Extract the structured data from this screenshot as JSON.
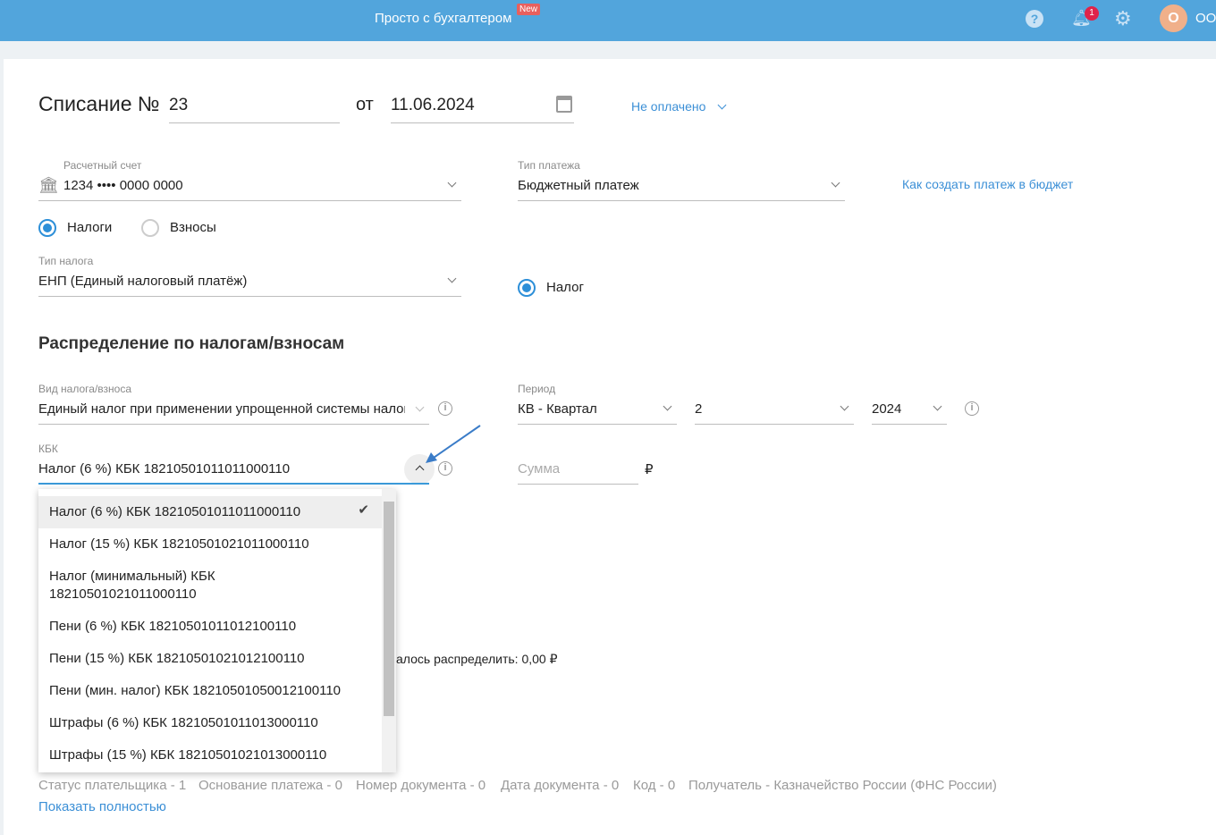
{
  "header": {
    "title": "Просто с бухгалтером",
    "new_badge": "New",
    "notif_count": "1",
    "avatar_letter": "О",
    "org": "ООО"
  },
  "doc": {
    "title": "Списание №",
    "number": "23",
    "from": "от",
    "date": "11.06.2024",
    "status": "Не оплачено"
  },
  "account": {
    "label": "Расчетный счет",
    "value": "1234 •••• 0000 0000"
  },
  "payment_type": {
    "label": "Тип платежа",
    "value": "Бюджетный платеж"
  },
  "budget_link": "Как создать платеж в бюджет",
  "radios": {
    "taxes": "Налоги",
    "contributions": "Взносы",
    "tax": "Налог"
  },
  "tax_type": {
    "label": "Тип налога",
    "value": "ЕНП (Единый налоговый платёж)"
  },
  "section_title": "Распределение по налогам/взносам",
  "kind": {
    "label": "Вид налога/взноса",
    "value": "Единый налог при применении упрощенной системы налогообложения"
  },
  "period": {
    "label": "Период",
    "type": "КВ - Квартал",
    "number": "2",
    "year": "2024"
  },
  "kbk": {
    "label": "КБК",
    "value": "Налог (6 %) КБК 18210501011011000110",
    "options": [
      "Налог (6 %) КБК 18210501011011000110",
      "Налог (15 %) КБК 18210501021011000110",
      "Налог (минимальный) КБК 18210501021011000110",
      "Пени (6 %) КБК 18210501011012100110",
      "Пени (15 %) КБК 18210501021012100110",
      "Пени (мин. налог) КБК 18210501050012100110",
      "Штрафы (6 %) КБК 18210501011013000110",
      "Штрафы (15 %) КБК 18210501021013000110"
    ]
  },
  "sum": {
    "placeholder": "Сумма",
    "currency": "₽"
  },
  "remaining": "алось распределить: 0,00 ₽",
  "footer": {
    "status": "Статус плательщика - 1",
    "basis": "Основание платежа - 0",
    "docnum": "Номер документа - 0",
    "docdate": "Дата документа - 0",
    "code": "Код - 0",
    "recipient": "Получатель - Казначейство России (ФНС России)",
    "show_full": "Показать полностью"
  },
  "colors": {
    "header": "#52a5dc",
    "accent": "#2d8fd8",
    "badge": "#e8605e",
    "avatar": "#f0b08a"
  }
}
